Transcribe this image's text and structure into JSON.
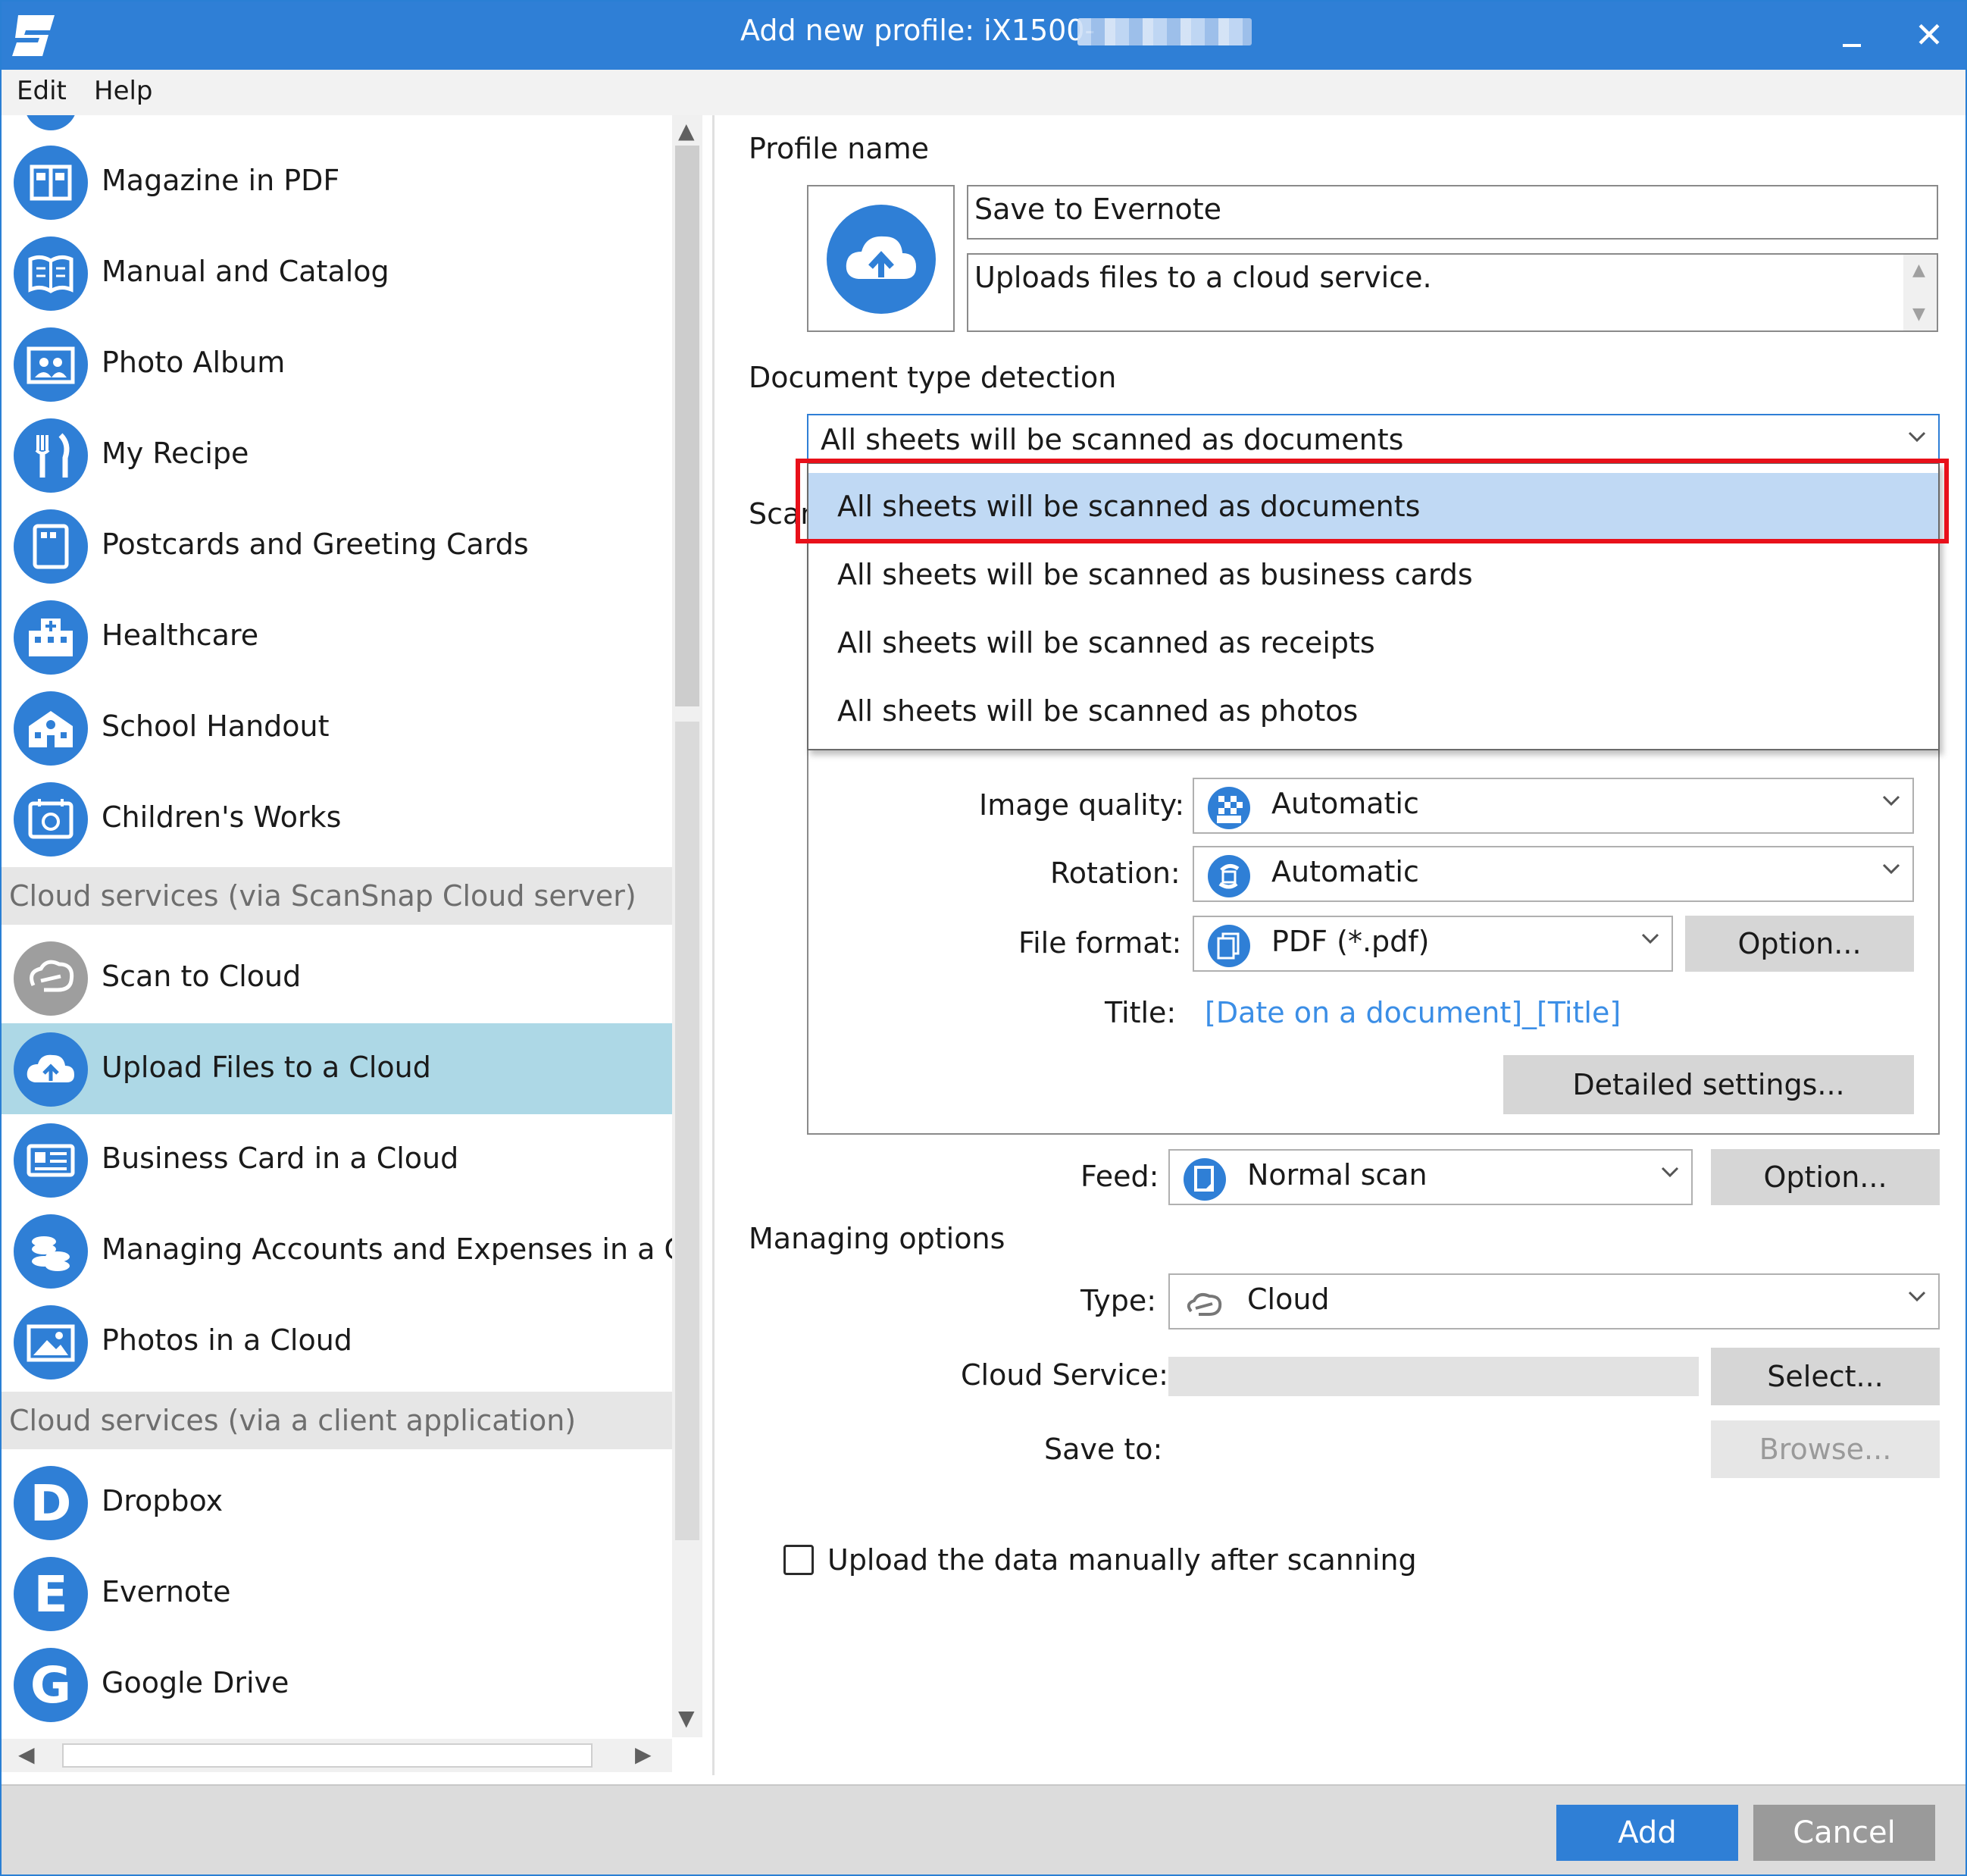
{
  "window": {
    "title": "Add new profile: iX1500-",
    "close_glyph": "✕"
  },
  "menu": [
    "Edit",
    "Help"
  ],
  "sidebar": {
    "items_top": [
      {
        "label": "Magazine in PDF",
        "icon": "magazine-icon"
      },
      {
        "label": "Manual and Catalog",
        "icon": "book-icon"
      },
      {
        "label": "Photo Album",
        "icon": "photo-album-icon"
      },
      {
        "label": "My Recipe",
        "icon": "recipe-icon"
      },
      {
        "label": "Postcards and Greeting Cards",
        "icon": "postcard-icon"
      },
      {
        "label": "Healthcare",
        "icon": "hospital-icon"
      },
      {
        "label": "School Handout",
        "icon": "school-icon"
      },
      {
        "label": "Children's Works",
        "icon": "children-works-icon"
      }
    ],
    "group_cloud_server": "Cloud services (via ScanSnap Cloud server)",
    "items_cloud": [
      {
        "label": "Scan to Cloud",
        "icon": "scansnap-cloud-icon"
      },
      {
        "label": "Upload Files to a Cloud",
        "icon": "cloud-upload-icon"
      },
      {
        "label": "Business Card in a Cloud",
        "icon": "business-card-icon"
      },
      {
        "label": "Managing Accounts and Expenses in a Clou",
        "icon": "coins-icon"
      },
      {
        "label": "Photos in a Cloud",
        "icon": "photo-icon"
      }
    ],
    "group_client_app": "Cloud services (via a client application)",
    "items_client": [
      {
        "label": "Dropbox",
        "letter": "D"
      },
      {
        "label": "Evernote",
        "letter": "E"
      },
      {
        "label": "Google Drive",
        "letter": "G"
      }
    ]
  },
  "form": {
    "profile_name_label": "Profile name",
    "profile_name_value": "Save to Evernote",
    "profile_desc_value": "Uploads files to a cloud service.",
    "doc_type_label": "Document type detection",
    "doc_type_value": "All sheets will be scanned as documents",
    "scan_label_partial": "Scan",
    "image_quality_label": "Image quality:",
    "image_quality_value": "Automatic",
    "rotation_label": "Rotation:",
    "rotation_value": "Automatic",
    "file_format_label": "File format:",
    "file_format_value": "PDF (*.pdf)",
    "option_label": "Option...",
    "title_label": "Title:",
    "title_value": "[Date on a document]_[Title]",
    "detailed_settings_label": "Detailed settings...",
    "feed_label": "Feed:",
    "feed_value": "Normal scan",
    "managing_options_label": "Managing options",
    "type_label": "Type:",
    "type_value": "Cloud",
    "cloud_service_label": "Cloud Service:",
    "select_label": "Select...",
    "save_to_label": "Save to:",
    "browse_label": "Browse...",
    "upload_manual_label": "Upload the data manually after scanning"
  },
  "dropdown_options": [
    "All sheets will be scanned as documents",
    "All sheets will be scanned as business cards",
    "All sheets will be scanned as receipts",
    "All sheets will be scanned as photos"
  ],
  "footer": {
    "add_label": "Add",
    "cancel_label": "Cancel"
  },
  "colors": {
    "accent": "#2f7fd6",
    "selected_row": "#add8e6",
    "dropdown_selected": "#c0d9f4",
    "highlight": "#e8101a",
    "link": "#3b8ee6"
  }
}
